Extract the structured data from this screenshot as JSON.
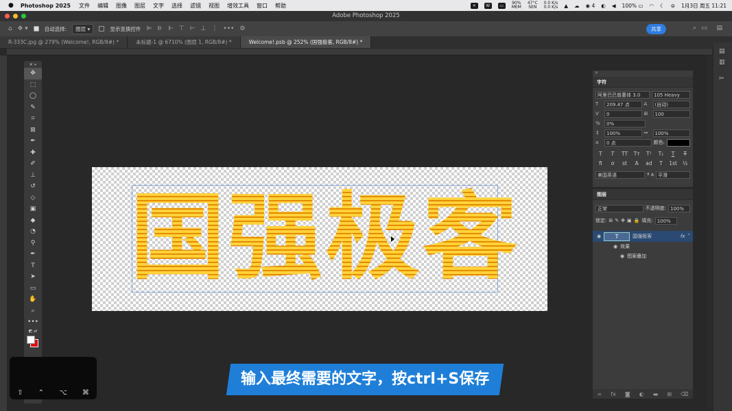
{
  "menubar": {
    "app_name": "Photoshop 2025",
    "items": [
      "文件",
      "编辑",
      "图像",
      "图层",
      "文字",
      "选择",
      "滤镜",
      "视图",
      "增效工具",
      "窗口",
      "帮助"
    ],
    "cpu": "90%",
    "mem_label": "MEM",
    "temp": "47°C",
    "sen_label": "SEN",
    "net_up": "0.0 K/s",
    "net_down": "0.0 K/s",
    "wechat_count": "4",
    "battery": "100%",
    "datetime": "1月3日 周五  11:21"
  },
  "window": {
    "title": "Adobe Photoshop 2025"
  },
  "options": {
    "auto_select_label": "自动选择:",
    "auto_select_value": "图层",
    "transform_label": "显示变换控件",
    "share_label": "共享"
  },
  "tabs": [
    {
      "label": "R-333C.jpg @ 279% (Welcome!, RGB/8#) *",
      "active": false
    },
    {
      "label": "未标题-1 @ 6710% (图层 1, RGB/8#) *",
      "active": false
    },
    {
      "label": "Welcome!.psb @ 252% (国强极客, RGB/8#) *",
      "active": true
    }
  ],
  "canvas": {
    "text": "国强极客"
  },
  "character_panel": {
    "title": "字符",
    "font_family": "阿里巴巴普惠体 3.0",
    "font_style": "105 Heavy",
    "font_size": "209.47 点",
    "leading": "(自动)",
    "kerning": "0",
    "tracking": "100",
    "tsume": "0%",
    "vertical_scale": "100%",
    "horizontal_scale": "100%",
    "baseline_shift": "0 点",
    "color_label": "颜色:",
    "language": "美国英语",
    "aa_label": "ª a",
    "antialias": "平滑",
    "type_buttons": [
      "T",
      "T",
      "TT",
      "Tт",
      "T¹",
      "T₁",
      "T",
      "T"
    ],
    "opentype_buttons": [
      "fi",
      "ơ",
      "st",
      "A",
      "ad",
      "T",
      "1st",
      "½"
    ]
  },
  "layers_panel": {
    "title": "图层",
    "blend_mode": "正常",
    "opacity_label": "不透明度:",
    "opacity": "100%",
    "lock_label": "锁定:",
    "fill_label": "填充:",
    "fill": "100%",
    "layer_name": "国强极客",
    "fx": "fx",
    "effects_label": "效果",
    "effect_item": "图案叠加"
  },
  "caption": {
    "text": "输入最终需要的文字，按ctrl+S保存"
  },
  "overlay_keys": [
    "⇧",
    "⌃",
    "⌥",
    "⌘"
  ],
  "colors": {
    "accent": "#1f7fd8",
    "share": "#2f7de1",
    "artwork": "#ffc21e"
  }
}
